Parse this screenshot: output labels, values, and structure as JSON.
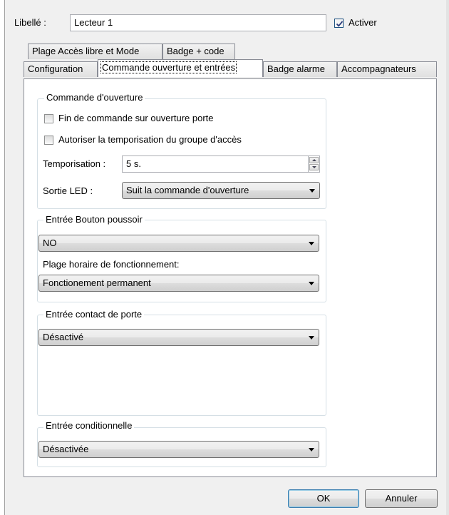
{
  "header": {
    "libelle_label": "Libellé :",
    "libelle_value": "Lecteur 1",
    "activer_label": "Activer",
    "activer_checked": true
  },
  "tabs": {
    "row1": [
      "Plage Accès libre et Mode",
      "Badge + code"
    ],
    "row2": [
      "Configuration",
      "Commande ouverture et entrées",
      "Badge alarme",
      "Accompagnateurs"
    ],
    "active": "Commande ouverture et entrées"
  },
  "commande": {
    "title": "Commande d'ouverture",
    "check1_label": "Fin de commande sur ouverture porte",
    "check1_checked": false,
    "check2_label": "Autoriser la temporisation du groupe d'accès",
    "check2_checked": false,
    "tempo_label": "Temporisation :",
    "tempo_value": "5 s.",
    "led_label": "Sortie LED :",
    "led_value": "Suit la commande d'ouverture"
  },
  "bouton": {
    "title": "Entrée Bouton poussoir",
    "value": "NO",
    "plage_label": "Plage horaire de fonctionnement:",
    "plage_value": "Fonctionement permanent"
  },
  "contact": {
    "title": "Entrée contact de porte",
    "value": "Désactivé"
  },
  "conditionnelle": {
    "title": "Entrée conditionnelle",
    "value": "Désactivée"
  },
  "buttons": {
    "ok": "OK",
    "cancel": "Annuler"
  },
  "icons": {
    "checkmark": "checkmark-icon",
    "dropdown": "chevron-down-icon",
    "spin_up": "arrow-up-icon",
    "spin_down": "arrow-down-icon"
  }
}
